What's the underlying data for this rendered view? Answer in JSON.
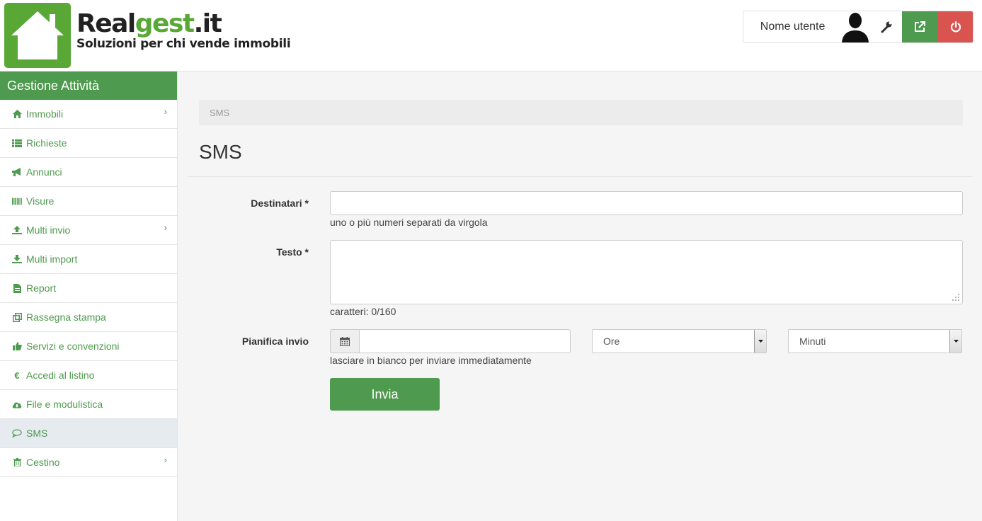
{
  "brand": {
    "name_prefix": "Real",
    "name_mid": "gest",
    "name_suffix": ".it",
    "tagline": "Soluzioni per chi vende immobili"
  },
  "user": {
    "name": "Nome utente"
  },
  "sidebar": {
    "title": "Gestione Attività",
    "items": [
      {
        "label": "Immobili",
        "icon": "home-icon",
        "has_submenu": true
      },
      {
        "label": "Richieste",
        "icon": "list-icon",
        "has_submenu": false
      },
      {
        "label": "Annunci",
        "icon": "bullhorn-icon",
        "has_submenu": false
      },
      {
        "label": "Visure",
        "icon": "barcode-icon",
        "has_submenu": false
      },
      {
        "label": "Multi invio",
        "icon": "upload-icon",
        "has_submenu": true
      },
      {
        "label": "Multi import",
        "icon": "download-icon",
        "has_submenu": false
      },
      {
        "label": "Report",
        "icon": "file-icon",
        "has_submenu": false
      },
      {
        "label": "Rassegna stampa",
        "icon": "clone-icon",
        "has_submenu": false
      },
      {
        "label": "Servizi e convenzioni",
        "icon": "thumbs-up-icon",
        "has_submenu": false
      },
      {
        "label": "Accedi al listino",
        "icon": "euro-icon",
        "has_submenu": false
      },
      {
        "label": "File e modulistica",
        "icon": "cloud-download-icon",
        "has_submenu": false
      },
      {
        "label": "SMS",
        "icon": "comment-icon",
        "has_submenu": false,
        "active": true
      },
      {
        "label": "Cestino",
        "icon": "trash-icon",
        "has_submenu": true
      }
    ]
  },
  "breadcrumb": "SMS",
  "page_title": "SMS",
  "form": {
    "recipients": {
      "label": "Destinatari *",
      "value": "",
      "help": "uno o più numeri separati da virgola"
    },
    "text": {
      "label": "Testo *",
      "value": "",
      "counter": "caratteri: 0/160"
    },
    "schedule": {
      "label": "Pianifica invio",
      "date_value": "",
      "hours_selected": "Ore",
      "minutes_selected": "Minuti",
      "help": "lasciare in bianco per inviare immediatamente"
    },
    "submit_label": "Invia"
  },
  "colors": {
    "accent": "#4e9a4e",
    "danger": "#d9534f",
    "active_item_bg": "#e6ebf0"
  }
}
